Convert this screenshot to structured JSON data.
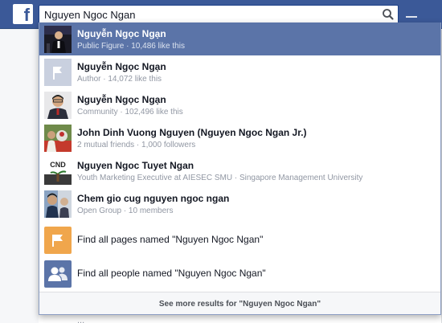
{
  "header": {
    "logo_letter": "f",
    "search_value": "Nguyen Ngoc Ngan",
    "search_icon": "search-icon"
  },
  "results": [
    {
      "title": "Nguyễn Ngọc Ngạn",
      "subtitle": "Public Figure · 10,486 like this",
      "selected": true,
      "thumb": "photo"
    },
    {
      "title": "Nguyễn Ngọc Ngạn",
      "subtitle": "Author · 14,072 like this",
      "selected": false,
      "thumb": "flag-icon"
    },
    {
      "title": "Nguyễn Ngọc Ngạn",
      "subtitle": "Community · 102,496 like this",
      "selected": false,
      "thumb": "photo"
    },
    {
      "title": "John Dinh Vuong Nguyen (Nguyen Ngoc Ngan Jr.)",
      "subtitle": "2 mutual friends · 1,000 followers",
      "selected": false,
      "thumb": "photo"
    },
    {
      "title": "Nguyen Ngoc Tuyet Ngan",
      "subtitle": "Youth Marketing Executive at AIESEC SMU · Singapore Management University",
      "selected": false,
      "thumb": "photo",
      "thumb_text": "CND"
    },
    {
      "title": "Chem gio cug nguyen ngoc ngan",
      "subtitle": "Open Group · 10 members",
      "selected": false,
      "thumb": "photo"
    }
  ],
  "find_actions": [
    {
      "label": "Find all pages named \"Nguyen Ngoc Ngan\"",
      "icon": "pages-flag-icon",
      "color": "#f0a64c"
    },
    {
      "label": "Find all people named \"Nguyen Ngoc Ngan\"",
      "icon": "people-icon",
      "color": "#5b74a8"
    }
  ],
  "see_more": "See more results for \"Nguyen Ngoc Ngan\"",
  "background_text": "...",
  "colors": {
    "brand": "#3b5998",
    "selected_row": "#5b74a8",
    "pages_orange": "#f0a64c"
  }
}
